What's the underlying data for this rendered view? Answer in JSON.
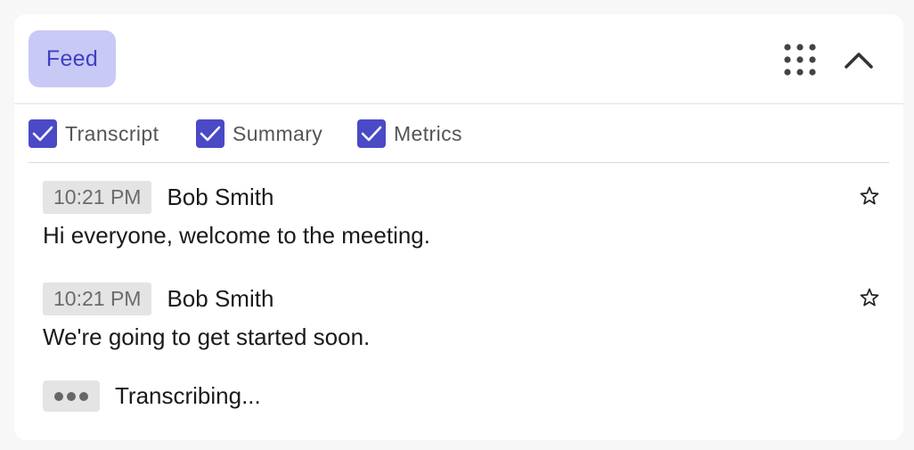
{
  "header": {
    "feed_tab_label": "Feed",
    "grid_icon": "grid-icon",
    "collapse_icon": "chevron-up-icon"
  },
  "filters": [
    {
      "label": "Transcript",
      "checked": true
    },
    {
      "label": "Summary",
      "checked": true
    },
    {
      "label": "Metrics",
      "checked": true
    }
  ],
  "messages": [
    {
      "time": "10:21 PM",
      "speaker": "Bob Smith",
      "text": "Hi everyone, welcome to the meeting.",
      "starred": false
    },
    {
      "time": "10:21 PM",
      "speaker": "Bob Smith",
      "text": "We're going to get started soon.",
      "starred": false
    }
  ],
  "status": {
    "label": "Transcribing..."
  },
  "colors": {
    "accent": "#4a49c6",
    "tab_bg": "#c9c9f5",
    "tab_text": "#3f3fc4"
  }
}
